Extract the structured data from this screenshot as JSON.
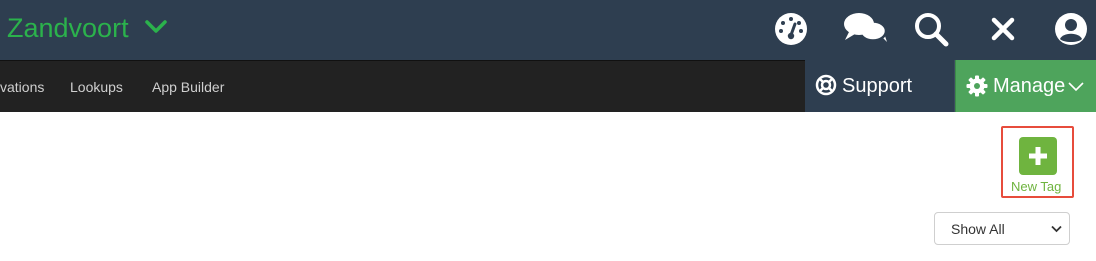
{
  "header": {
    "site_title": "Zandvoort",
    "icons": [
      "dashboard-gauge-icon",
      "chat-bubbles-icon",
      "search-icon",
      "close-icon",
      "user-avatar-icon"
    ]
  },
  "nav": {
    "items": [
      {
        "label": "vations"
      },
      {
        "label": "Lookups"
      },
      {
        "label": "App Builder"
      }
    ]
  },
  "support": {
    "label": "Support",
    "icon": "life-ring-icon"
  },
  "manage": {
    "label": "Manage",
    "icon": "gear-icon"
  },
  "actions": {
    "new_tag_label": "New Tag"
  },
  "filter": {
    "selected": "Show All"
  },
  "colors": {
    "topbar": "#2e3e50",
    "navbar": "#222222",
    "brand_green": "#2bb24c",
    "manage_green": "#4ea45c",
    "button_green": "#6fb43f",
    "highlight_red": "#e74c3c"
  }
}
